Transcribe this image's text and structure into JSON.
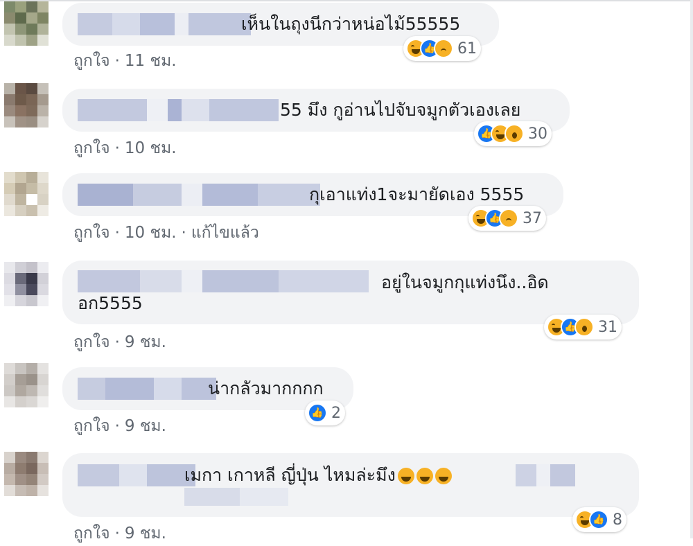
{
  "comments": [
    {
      "text": "เห็นในถุงนีกว่าหน่อไม้55555",
      "like": "ถูกใจ",
      "time": "11 ชม.",
      "edited": "",
      "count": "61",
      "icons": [
        "haha-icon",
        "like-icon",
        "sad-icon"
      ]
    },
    {
      "text": "55 มึง กูอ่านไปจับจมูกตัวเองเลย",
      "like": "ถูกใจ",
      "time": "10 ชม.",
      "edited": "",
      "count": "30",
      "icons": [
        "like-icon",
        "haha-icon",
        "wow-icon"
      ]
    },
    {
      "text": "กุเอาแท่ง1จะมายัดเอง 5555",
      "like": "ถูกใจ",
      "time": "10 ชม.",
      "edited": "แก้ไขแล้ว",
      "count": "37",
      "icons": [
        "haha-icon",
        "like-icon",
        "sad-icon"
      ]
    },
    {
      "text": "อยู่ในจมูกกุแท่งนึง..อิด",
      "text2": "อก5555",
      "like": "ถูกใจ",
      "time": "9 ชม.",
      "edited": "",
      "count": "31",
      "icons": [
        "haha-icon",
        "like-icon",
        "wow-icon"
      ]
    },
    {
      "text": "น่ากลัวมากกกก",
      "like": "ถูกใจ",
      "time": "9 ชม.",
      "edited": "",
      "count": "2",
      "icons": [
        "like-icon"
      ]
    },
    {
      "text": "เมกา เกาหลี ญี่ปุ่น ไหมล่ะมึง",
      "emoji_count": 3,
      "like": "ถูกใจ",
      "time": "9 ชม.",
      "edited": "",
      "count": "8",
      "icons": [
        "haha-icon",
        "like-icon"
      ]
    }
  ],
  "colors": {
    "accent": "#1877f2",
    "bubble": "#f2f3f5",
    "meta": "#606770"
  }
}
